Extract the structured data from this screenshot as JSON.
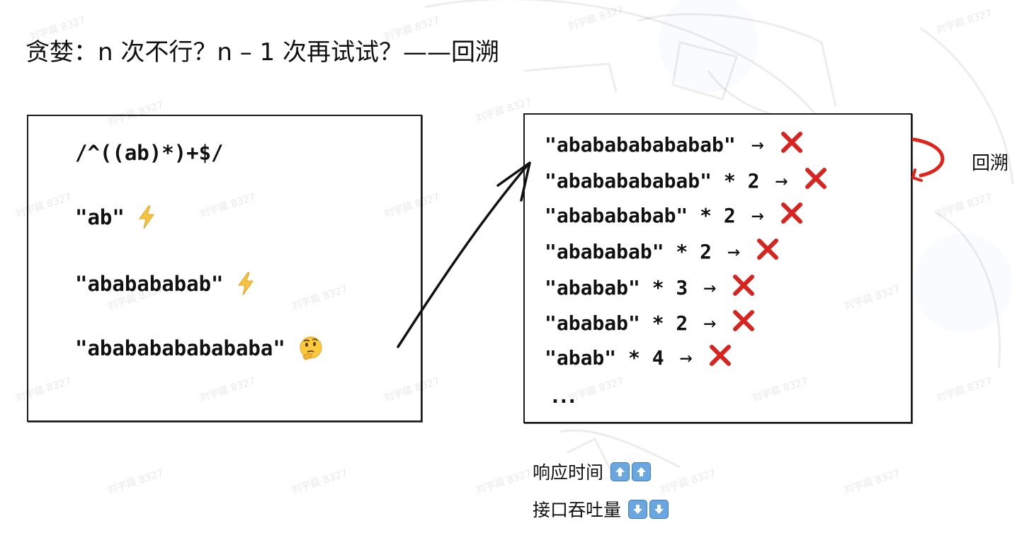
{
  "title": "贪婪：n 次不行？n – 1 次再试试？——回溯",
  "left_box": {
    "regex": "/^((ab)*)+$/",
    "examples": [
      {
        "text": "\"ab\"",
        "icon": "lightning-icon"
      },
      {
        "text": "\"ababababab\"",
        "icon": "lightning-icon"
      },
      {
        "text": "\"abababababababa\"",
        "icon": "thinking-face-icon"
      }
    ]
  },
  "right_box": {
    "attempts": [
      {
        "text": "\"ababababababab\"",
        "arrow": "→"
      },
      {
        "text": "\"abababababab\" * 2",
        "arrow": "→"
      },
      {
        "text": "\"ababababab\" * 2",
        "arrow": "→"
      },
      {
        "text": "\"abababab\" * 2",
        "arrow": "→"
      },
      {
        "text": "\"ababab\" * 3",
        "arrow": "→"
      },
      {
        "text": "\"ababab\" * 2",
        "arrow": "→"
      },
      {
        "text": "\"abab\" * 4",
        "arrow": "→"
      }
    ],
    "ellipsis": "..."
  },
  "backtrack_label": "回溯",
  "metrics": [
    {
      "label": "响应时间",
      "direction": "up",
      "icon": "up-arrow-icon"
    },
    {
      "label": "接口吞吐量",
      "direction": "down",
      "icon": "down-arrow-icon"
    }
  ],
  "watermark": "刘宇晨 8327",
  "colors": {
    "cross": "#d9231f",
    "curve": "#e0241c",
    "badge": "#6aa7e0"
  }
}
